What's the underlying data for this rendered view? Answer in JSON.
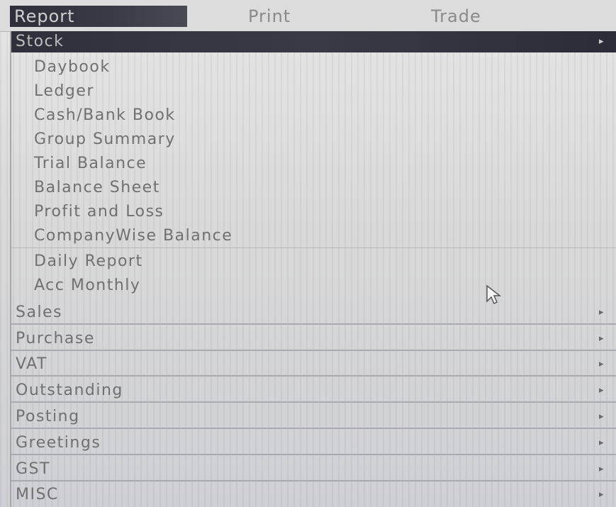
{
  "menubar": {
    "items": [
      "Report",
      "Print",
      "Trade"
    ]
  },
  "dropdown": {
    "header": {
      "label": "Stock",
      "arrow": "▸"
    },
    "items": [
      "Daybook",
      "Ledger",
      "Cash/Bank Book",
      "Group Summary",
      "Trial Balance",
      "Balance Sheet",
      "Profit and Loss",
      "CompanyWise Balance",
      "Daily Report",
      "Acc Monthly"
    ],
    "submenus": [
      {
        "label": "Sales",
        "arrow": "▸"
      },
      {
        "label": "Purchase",
        "arrow": "▸"
      },
      {
        "label": "VAT",
        "arrow": "▸"
      },
      {
        "label": "Outstanding",
        "arrow": "▸"
      },
      {
        "label": "Posting",
        "arrow": "▸"
      },
      {
        "label": "Greetings",
        "arrow": "▸"
      },
      {
        "label": "GST",
        "arrow": "▸"
      },
      {
        "label": "MISC",
        "arrow": "▸"
      }
    ]
  },
  "colors": {
    "highlight": "#30303c",
    "background": "#d9d9d9",
    "text": "#707070"
  },
  "icons": {
    "cursor": "mouse-pointer-icon",
    "submenu": "chevron-right-icon"
  }
}
